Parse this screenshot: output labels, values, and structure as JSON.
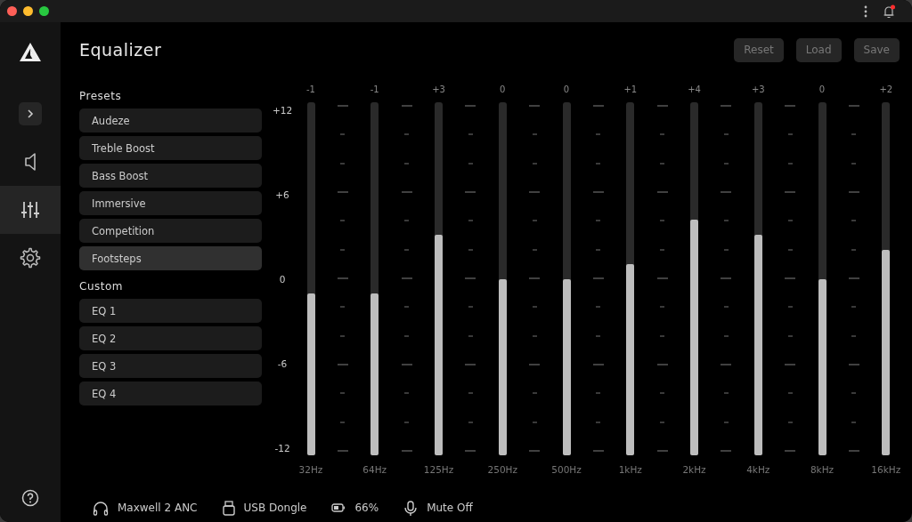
{
  "window": {
    "title_bar_buttons": [
      {
        "kind": "close"
      },
      {
        "kind": "minimize"
      },
      {
        "kind": "zoom"
      }
    ],
    "notification": true
  },
  "sidebar": {
    "items": [
      {
        "kind": "expand",
        "selected": false
      },
      {
        "kind": "speaker",
        "selected": false
      },
      {
        "kind": "equalizer",
        "selected": true
      },
      {
        "kind": "settings",
        "selected": false
      }
    ],
    "footer": {
      "kind": "help"
    }
  },
  "header": {
    "title": "Equalizer",
    "buttons": [
      "Reset",
      "Load",
      "Save"
    ]
  },
  "presets": {
    "heading": "Presets",
    "items": [
      {
        "label": "Audeze",
        "selected": false
      },
      {
        "label": "Treble Boost",
        "selected": false
      },
      {
        "label": "Bass Boost",
        "selected": false
      },
      {
        "label": "Immersive",
        "selected": false
      },
      {
        "label": "Competition",
        "selected": false
      },
      {
        "label": "Footsteps",
        "selected": true
      }
    ]
  },
  "custom": {
    "heading": "Custom",
    "items": [
      {
        "label": "EQ 1",
        "selected": false
      },
      {
        "label": "EQ 2",
        "selected": false
      },
      {
        "label": "EQ 3",
        "selected": false
      },
      {
        "label": "EQ 4",
        "selected": false
      }
    ]
  },
  "equalizer": {
    "scale": [
      "+12",
      "+6",
      "0",
      "-6",
      "-12"
    ],
    "bands": [
      {
        "gain": "-1",
        "frequency": "32Hz",
        "level": 0.458
      },
      {
        "gain": "-1",
        "frequency": "64Hz",
        "level": 0.458
      },
      {
        "gain": "+3",
        "frequency": "125Hz",
        "level": 0.625
      },
      {
        "gain": "0",
        "frequency": "250Hz",
        "level": 0.5
      },
      {
        "gain": "0",
        "frequency": "500Hz",
        "level": 0.5
      },
      {
        "gain": "+1",
        "frequency": "1kHz",
        "level": 0.542
      },
      {
        "gain": "+4",
        "frequency": "2kHz",
        "level": 0.667
      },
      {
        "gain": "+3",
        "frequency": "4kHz",
        "level": 0.625
      },
      {
        "gain": "0",
        "frequency": "8kHz",
        "level": 0.5
      },
      {
        "gain": "+2",
        "frequency": "16kHz",
        "level": 0.583
      }
    ]
  },
  "status_bar": [
    {
      "kind": "headphones",
      "text": "Maxwell 2 ANC"
    },
    {
      "kind": "usb",
      "text": "USB Dongle"
    },
    {
      "kind": "battery",
      "text": "66%"
    },
    {
      "kind": "microphone",
      "text": "Mute Off"
    }
  ]
}
